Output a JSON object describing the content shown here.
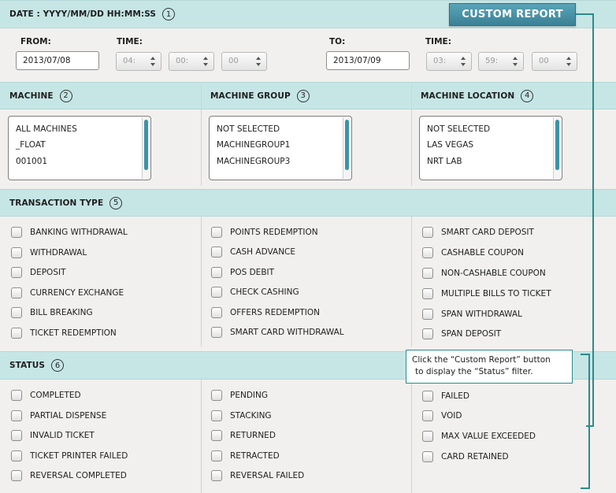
{
  "date_band": {
    "title": "DATE : YYYY/MM/DD HH:MM:SS",
    "callout": "1"
  },
  "custom_report_label": "CUSTOM REPORT",
  "from": {
    "label": "FROM:",
    "date": "2013/07/08",
    "time_label": "TIME:",
    "hh": "04:",
    "mm": "00:",
    "ss": "00"
  },
  "to": {
    "label": "TO:",
    "date": "2013/07/09",
    "time_label": "TIME:",
    "hh": "03:",
    "mm": "59:",
    "ss": "00"
  },
  "machine": {
    "title": "MACHINE",
    "callout": "2",
    "options": [
      "ALL MACHINES",
      "_FLOAT",
      "001001"
    ]
  },
  "machine_group": {
    "title": "MACHINE GROUP",
    "callout": "3",
    "options": [
      "NOT SELECTED",
      "MACHINEGROUP1",
      "MACHINEGROUP3"
    ]
  },
  "machine_location": {
    "title": "MACHINE LOCATION",
    "callout": "4",
    "options": [
      "NOT SELECTED",
      "LAS VEGAS",
      "NRT LAB"
    ]
  },
  "transaction_type": {
    "title": "TRANSACTION TYPE",
    "callout": "5",
    "col1": [
      "BANKING WITHDRAWAL",
      "WITHDRAWAL",
      "DEPOSIT",
      "CURRENCY EXCHANGE",
      "BILL BREAKING",
      "TICKET REDEMPTION"
    ],
    "col2": [
      "POINTS REDEMPTION",
      "CASH ADVANCE",
      "POS DEBIT",
      "CHECK CASHING",
      "OFFERS REDEMPTION",
      "SMART CARD WITHDRAWAL"
    ],
    "col3": [
      "SMART CARD DEPOSIT",
      "CASHABLE COUPON",
      "NON-CASHABLE COUPON",
      "MULTIPLE BILLS TO TICKET",
      "SPAN WITHDRAWAL",
      "SPAN DEPOSIT"
    ]
  },
  "status": {
    "title": "STATUS",
    "callout": "6",
    "col1": [
      "COMPLETED",
      "PARTIAL DISPENSE",
      "INVALID TICKET",
      "TICKET PRINTER FAILED",
      "REVERSAL COMPLETED"
    ],
    "col2": [
      "PENDING",
      "STACKING",
      "RETURNED",
      "RETRACTED",
      "REVERSAL FAILED"
    ],
    "col3": [
      "FAILED",
      "VOID",
      "MAX VALUE EXCEEDED",
      "CARD RETAINED"
    ]
  },
  "tooltip": {
    "line1": "Click the “Custom Report” button",
    "line2": "to display the “Status” filter."
  },
  "colors": {
    "band": "#c6e6e6",
    "button": "#3b8196",
    "scroll_thumb": "#3d93a8",
    "callout_line": "#2f8a8a"
  }
}
